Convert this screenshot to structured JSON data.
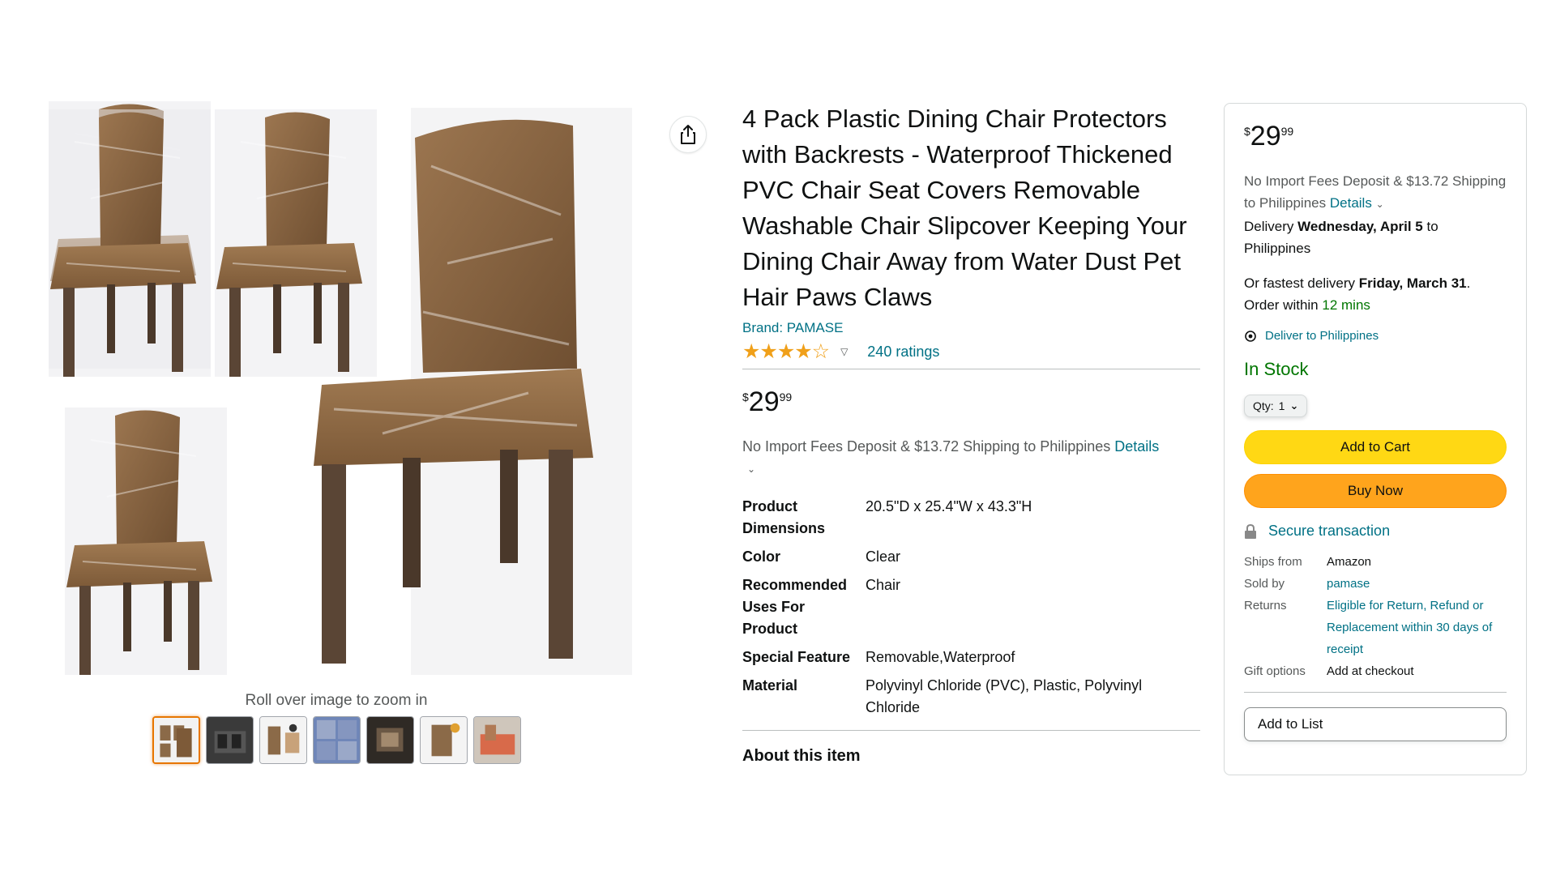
{
  "product": {
    "title": "4 Pack Plastic Dining Chair Protectors with Backrests - Waterproof Thickened PVC Chair Seat Covers Removable Washable Chair Slipcover Keeping Your Dining Chair Away from Water Dust Pet Hair Paws Claws",
    "brand": "Brand: PAMASE",
    "rating_value": 4,
    "stars": "★★★★☆",
    "ratings_count": "240 ratings",
    "price": {
      "symbol": "$",
      "whole": "29",
      "fraction": "99"
    },
    "shipping_text": "No Import Fees Deposit & $13.72 Shipping to Philippines",
    "shipping_details": "Details",
    "specs": [
      {
        "key": "Product Dimensions",
        "value": "20.5\"D x 25.4\"W x 43.3\"H"
      },
      {
        "key": "Color",
        "value": "Clear"
      },
      {
        "key": "Recommended Uses For Product",
        "value": "Chair"
      },
      {
        "key": "Special Feature",
        "value": "Removable,Waterproof"
      },
      {
        "key": "Material",
        "value": "Polyvinyl Chloride (PVC), Plastic, Polyvinyl Chloride"
      }
    ],
    "about_heading": "About this item"
  },
  "gallery": {
    "zoom_hint": "Roll over image to zoom in",
    "thumbnail_count": 7,
    "active_index": 0,
    "icons": {
      "share": "share-icon"
    }
  },
  "buybox": {
    "price": {
      "symbol": "$",
      "whole": "29",
      "fraction": "99"
    },
    "shipping_text": "No Import Fees Deposit & $13.72 Shipping to Philippines",
    "shipping_details": "Details",
    "delivery_prefix": "Delivery",
    "delivery_date": "Wednesday, April 5",
    "delivery_suffix": "to Philippines",
    "fastest_prefix": "Or fastest delivery",
    "fastest_date": "Friday, March 31",
    "order_within_prefix": "Order within",
    "order_within_time": "12 mins",
    "deliver_to": "Deliver to Philippines",
    "stock_status": "In Stock",
    "qty_label": "Qty:",
    "qty_value": "1",
    "add_to_cart": "Add to Cart",
    "buy_now": "Buy Now",
    "secure": "Secure transaction",
    "info": [
      {
        "key": "Ships from",
        "value": "Amazon",
        "link": false
      },
      {
        "key": "Sold by",
        "value": "pamase",
        "link": true
      },
      {
        "key": "Returns",
        "value": "Eligible for Return, Refund or Replacement within 30 days of receipt",
        "link": true
      },
      {
        "key": "Gift options",
        "value": "Add at checkout",
        "link": false
      }
    ],
    "add_to_list": "Add to List"
  },
  "colors": {
    "link": "#007185",
    "in_stock": "#007600",
    "add_to_cart_bg": "#FFD814",
    "buy_now_bg": "#FFA41C",
    "star": "#F0A01A",
    "active_thumb_border": "#E77600"
  }
}
